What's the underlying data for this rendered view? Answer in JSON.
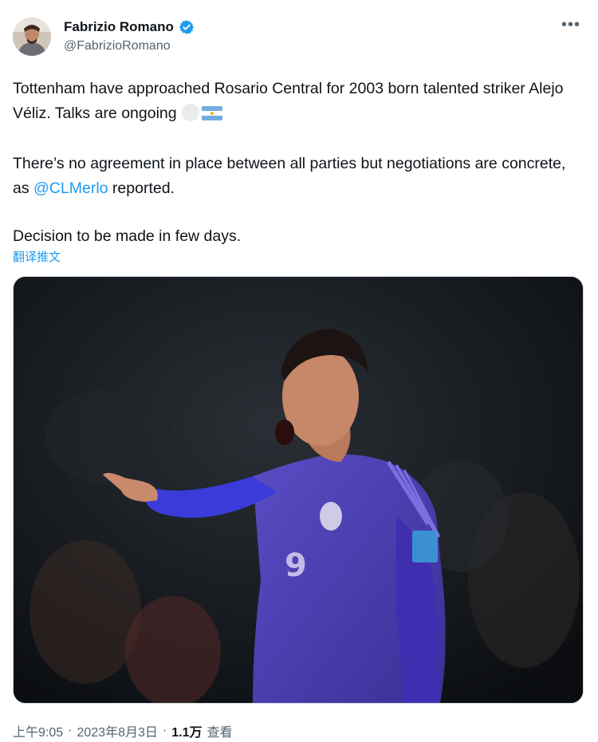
{
  "author": {
    "display_name": "Fabrizio Romano",
    "handle": "@FabrizioRomano",
    "verified": true,
    "avatar_icon": "profile-photo-avatar",
    "badge_icon": "verified-badge-icon"
  },
  "more_icon": "more-options-icon",
  "tweet": {
    "p1": "Tottenham have approached Rosario Central for 2003 born talented striker Alejo Véliz. Talks are ongoing",
    "p1_emojis": [
      "white-circle-emoji",
      "argentina-flag-emoji"
    ],
    "p2_before": "There’s no agreement in place between all parties but negotiations are concrete, as ",
    "p2_mention": "@CLMerlo",
    "p2_after": " reported.",
    "p3": "Decision to be made in few days."
  },
  "translate_label": "翻译推文",
  "media": {
    "type": "photo",
    "subject": "player-in-purple-argentina-jersey-number-9-pointing"
  },
  "meta": {
    "time": "上午9:05",
    "separator": "·",
    "date": "2023年8月3日",
    "views_count": "1.1万",
    "views_label": "查看"
  },
  "colors": {
    "link": "#1d9bf0",
    "secondary_text": "#536471",
    "primary_text": "#0f1419",
    "jersey": "#4a3fa8"
  }
}
